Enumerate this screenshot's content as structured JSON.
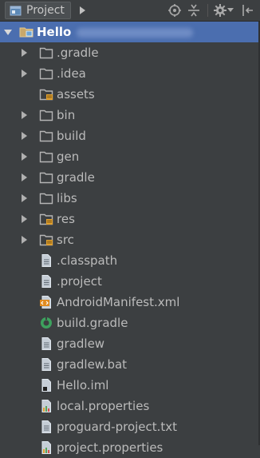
{
  "toolbar": {
    "view_label": "Project",
    "icons": [
      "project-view-icon",
      "dropdown-arrow-icon",
      "scroll-from-source-icon",
      "collapse-all-icon",
      "gear-icon",
      "hide-panel-icon"
    ]
  },
  "tree": {
    "root": {
      "label": "Hello",
      "icon": "module-folder-icon",
      "expanded": true,
      "selected": true
    },
    "items": [
      {
        "label": ".gradle",
        "icon": "folder-icon",
        "expandable": true
      },
      {
        "label": ".idea",
        "icon": "folder-icon",
        "expandable": true
      },
      {
        "label": "assets",
        "icon": "resource-folder-icon",
        "expandable": false
      },
      {
        "label": "bin",
        "icon": "folder-icon",
        "expandable": true
      },
      {
        "label": "build",
        "icon": "folder-icon",
        "expandable": true
      },
      {
        "label": "gen",
        "icon": "folder-icon",
        "expandable": true
      },
      {
        "label": "gradle",
        "icon": "folder-icon",
        "expandable": true
      },
      {
        "label": "libs",
        "icon": "folder-icon",
        "expandable": true
      },
      {
        "label": "res",
        "icon": "resource-folder-icon",
        "expandable": true
      },
      {
        "label": "src",
        "icon": "resource-folder-icon",
        "expandable": true
      },
      {
        "label": ".classpath",
        "icon": "text-file-icon",
        "expandable": false
      },
      {
        "label": ".project",
        "icon": "text-file-icon",
        "expandable": false
      },
      {
        "label": "AndroidManifest.xml",
        "icon": "xml-file-icon",
        "expandable": false
      },
      {
        "label": "build.gradle",
        "icon": "gradle-file-icon",
        "expandable": false
      },
      {
        "label": "gradlew",
        "icon": "text-file-icon",
        "expandable": false
      },
      {
        "label": "gradlew.bat",
        "icon": "text-file-icon",
        "expandable": false
      },
      {
        "label": "Hello.iml",
        "icon": "iml-file-icon",
        "expandable": false
      },
      {
        "label": "local.properties",
        "icon": "properties-file-icon",
        "expandable": false
      },
      {
        "label": "proguard-project.txt",
        "icon": "text-file-icon",
        "expandable": false
      },
      {
        "label": "project.properties",
        "icon": "properties-file-icon",
        "expandable": false
      }
    ]
  },
  "colors": {
    "background": "#3c3f41",
    "selection": "#4b6eaf",
    "text": "#bbbbbb",
    "folder": "#b5b5b5",
    "resource_badge": "#e0a030"
  }
}
